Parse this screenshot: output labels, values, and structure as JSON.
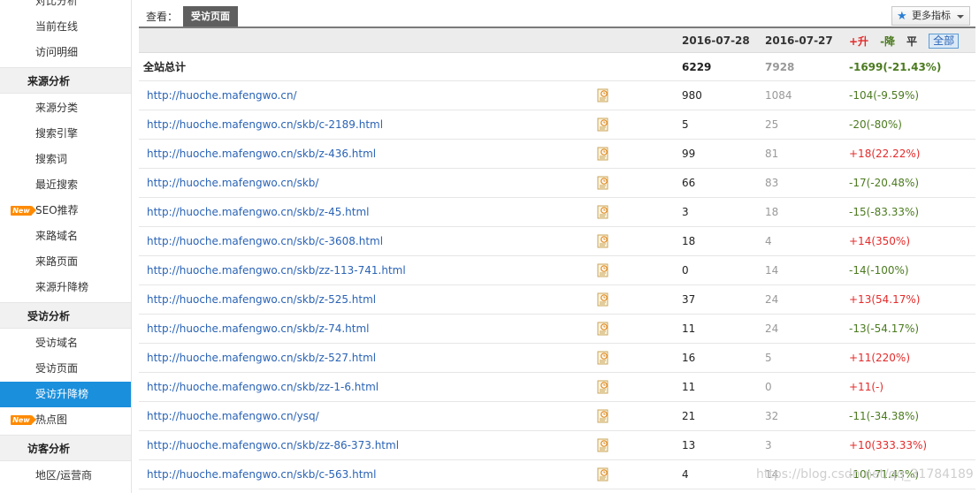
{
  "sidebar": {
    "items": [
      {
        "label": "对比分析",
        "type": "partial"
      },
      {
        "label": "当前在线",
        "type": "item"
      },
      {
        "label": "访问明细",
        "type": "item"
      },
      {
        "label": "来源分析",
        "type": "header"
      },
      {
        "label": "来源分类",
        "type": "item"
      },
      {
        "label": "搜索引擎",
        "type": "item"
      },
      {
        "label": "搜索词",
        "type": "item"
      },
      {
        "label": "最近搜索",
        "type": "item"
      },
      {
        "label": "SEO推荐",
        "type": "item",
        "badge": "New"
      },
      {
        "label": "来路域名",
        "type": "item"
      },
      {
        "label": "来路页面",
        "type": "item"
      },
      {
        "label": "来源升降榜",
        "type": "item"
      },
      {
        "label": "受访分析",
        "type": "header"
      },
      {
        "label": "受访域名",
        "type": "item"
      },
      {
        "label": "受访页面",
        "type": "item"
      },
      {
        "label": "受访升降榜",
        "type": "item",
        "active": true
      },
      {
        "label": "热点图",
        "type": "item",
        "badge": "New"
      },
      {
        "label": "访客分析",
        "type": "header"
      },
      {
        "label": "地区/运营商",
        "type": "item"
      }
    ]
  },
  "topbar": {
    "view_label": "查看：",
    "view_tab": "受访页面",
    "more_button": "更多指标"
  },
  "table": {
    "date1": "2016-07-28",
    "date2": "2016-07-27",
    "filters": {
      "up": "+升",
      "down": "-降",
      "flat": "平",
      "all": "全部"
    },
    "total": {
      "label": "全站总计",
      "v1": "6229",
      "v2": "7928",
      "change": "-1699(-21.43%)",
      "dir": "down"
    },
    "rows": [
      {
        "url": "http://huoche.mafengwo.cn/",
        "v1": "980",
        "v2": "1084",
        "change": "-104(-9.59%)",
        "dir": "down"
      },
      {
        "url": "http://huoche.mafengwo.cn/skb/c-2189.html",
        "v1": "5",
        "v2": "25",
        "change": "-20(-80%)",
        "dir": "down"
      },
      {
        "url": "http://huoche.mafengwo.cn/skb/z-436.html",
        "v1": "99",
        "v2": "81",
        "change": "+18(22.22%)",
        "dir": "up"
      },
      {
        "url": "http://huoche.mafengwo.cn/skb/",
        "v1": "66",
        "v2": "83",
        "change": "-17(-20.48%)",
        "dir": "down"
      },
      {
        "url": "http://huoche.mafengwo.cn/skb/z-45.html",
        "v1": "3",
        "v2": "18",
        "change": "-15(-83.33%)",
        "dir": "down"
      },
      {
        "url": "http://huoche.mafengwo.cn/skb/c-3608.html",
        "v1": "18",
        "v2": "4",
        "change": "+14(350%)",
        "dir": "up"
      },
      {
        "url": "http://huoche.mafengwo.cn/skb/zz-113-741.html",
        "v1": "0",
        "v2": "14",
        "change": "-14(-100%)",
        "dir": "down"
      },
      {
        "url": "http://huoche.mafengwo.cn/skb/z-525.html",
        "v1": "37",
        "v2": "24",
        "change": "+13(54.17%)",
        "dir": "up"
      },
      {
        "url": "http://huoche.mafengwo.cn/skb/z-74.html",
        "v1": "11",
        "v2": "24",
        "change": "-13(-54.17%)",
        "dir": "down"
      },
      {
        "url": "http://huoche.mafengwo.cn/skb/z-527.html",
        "v1": "16",
        "v2": "5",
        "change": "+11(220%)",
        "dir": "up"
      },
      {
        "url": "http://huoche.mafengwo.cn/skb/zz-1-6.html",
        "v1": "11",
        "v2": "0",
        "change": "+11(-)",
        "dir": "up"
      },
      {
        "url": "http://huoche.mafengwo.cn/ysq/",
        "v1": "21",
        "v2": "32",
        "change": "-11(-34.38%)",
        "dir": "down"
      },
      {
        "url": "http://huoche.mafengwo.cn/skb/zz-86-373.html",
        "v1": "13",
        "v2": "3",
        "change": "+10(333.33%)",
        "dir": "up"
      },
      {
        "url": "http://huoche.mafengwo.cn/skb/c-563.html",
        "v1": "4",
        "v2": "14",
        "change": "-10(-71.43%)",
        "dir": "down"
      }
    ]
  },
  "watermark": "https://blog.csdn.net/qq_31784189",
  "colors": {
    "up": "#e32b2b",
    "down": "#4b7a1f",
    "link": "#2a63b5",
    "active": "#1a8fdc"
  }
}
